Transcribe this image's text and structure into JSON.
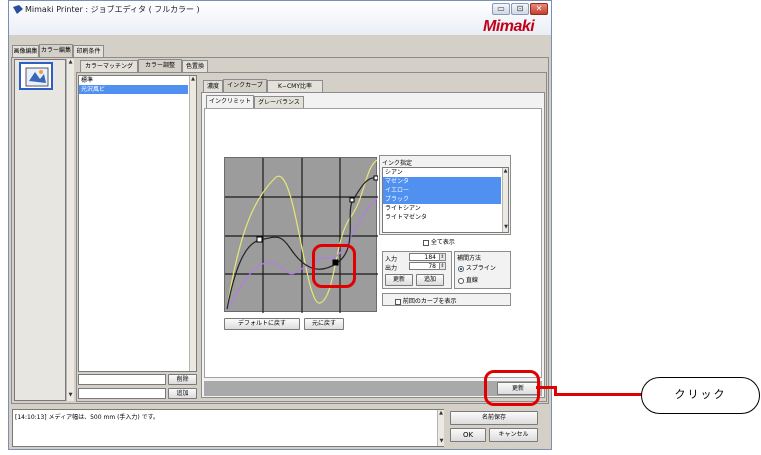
{
  "window": {
    "title": "Mimaki Printer : ジョブエディタ ( フルカラー )",
    "logo": "Mimaki",
    "buttons": [
      "▭",
      "⊡",
      "✕"
    ]
  },
  "main_tabs": [
    "画像編集",
    "カラー編集",
    "印刷条件"
  ],
  "sub_tabs": [
    "カラーマッチング",
    "カラー調整",
    "色置換"
  ],
  "preset_list": {
    "items": [
      "標準",
      "光沢風ビ"
    ],
    "selected_index": 1,
    "delete_label": "削除",
    "add_label": "追加"
  },
  "curve_tabs": [
    "濃度",
    "インクカーブ",
    "K−CMY比率"
  ],
  "curve_subtabs": [
    "インクリミット",
    "グレーバランス"
  ],
  "ink_panel": {
    "header": "インク指定",
    "inks": [
      "シアン",
      "マゼンタ",
      "イエロー",
      "ブラック",
      "ライトシアン",
      "ライトマゼンタ"
    ],
    "selected": [
      1,
      2,
      3
    ],
    "show_all": "全て表示"
  },
  "io": {
    "input_label": "入力",
    "input_value": "184",
    "output_label": "出力",
    "output_value": "78",
    "update_label": "更新",
    "add_label": "追加"
  },
  "interp": {
    "label": "補間方法",
    "options": [
      "スプライン",
      "直線"
    ],
    "selected": 0
  },
  "prev_curve_label": "前回のカーブを表示",
  "graph_buttons": {
    "default": "デフォルトに戻す",
    "restore": "元に戻す"
  },
  "update_button": "更新",
  "status_message": "[14:10:13] メディア幅は、500 mm (手入力) です。",
  "bottom_buttons": {
    "save": "名前保存",
    "ok": "OK",
    "cancel": "キャンセル"
  },
  "callout_text": "クリック",
  "colors": {
    "highlight": "#e00000",
    "selection": "#4f90f0",
    "curve_black": "#222222",
    "curve_yellow": "#e6e67a",
    "curve_magenta": "#b07ee6"
  },
  "icons": [
    "app-icon",
    "thumbnail-icon",
    "scroll-up-icon",
    "scroll-down-icon",
    "spinner-icon"
  ]
}
